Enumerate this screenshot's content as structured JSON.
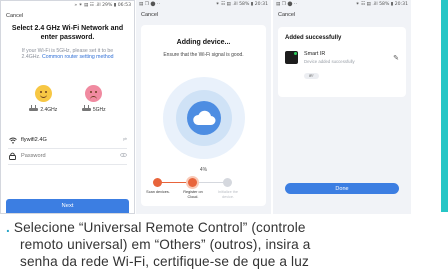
{
  "screen1": {
    "status_text": "» ✶ ▤ ☷ .ill 29% ▮ 06:53",
    "cancel": "Cancel",
    "title": "Select 2.4 GHz Wi-Fi Network and enter password.",
    "description": "If your Wi-Fi is 5GHz, please set it to be 2.4GHz.",
    "description_link": "Common router setting method",
    "band_24": "2.4GHz",
    "band_5": "5GHz",
    "wifi_name": "flywifi2.4G",
    "wifi_tail": "⇌",
    "password_placeholder": "Password",
    "next": "Next"
  },
  "screen2": {
    "status_left": "▤ ❒ ⬤ ··",
    "status_right": "✶ ☷ ▤ .ill 58% ▮ 20:31",
    "cancel": "Cancel",
    "title": "Adding device...",
    "subtitle": "Ensure that the Wi-Fi signal is good.",
    "progress_percent": "4%",
    "steps": [
      {
        "label": "Scan devices."
      },
      {
        "label": "Register on Cloud."
      },
      {
        "label": "Initialize the device."
      }
    ],
    "accent_color": "#e8643b",
    "cloud_color": "#4d8de2"
  },
  "screen3": {
    "status_left": "▤ ❒ ⬤ ··",
    "status_right": "✶ ☷ ▤ .ill 58% ▮ 20:31",
    "cancel": "Cancel",
    "title": "Added successfully",
    "device_name": "Smart IR",
    "device_status": "Device added successfully",
    "room": "IR’",
    "done": "Done"
  },
  "caption": {
    "bullet": ".",
    "line1": "Selecione “Universal Remote Control” (controle",
    "line2": "remoto universal) em “Others” (outros), insira a",
    "line3": "senha da rede Wi-Fi, certifique-se de que a luz"
  },
  "colors": {
    "primary_button": "#3c7ee2",
    "accent_strip": "#26c6c6"
  }
}
